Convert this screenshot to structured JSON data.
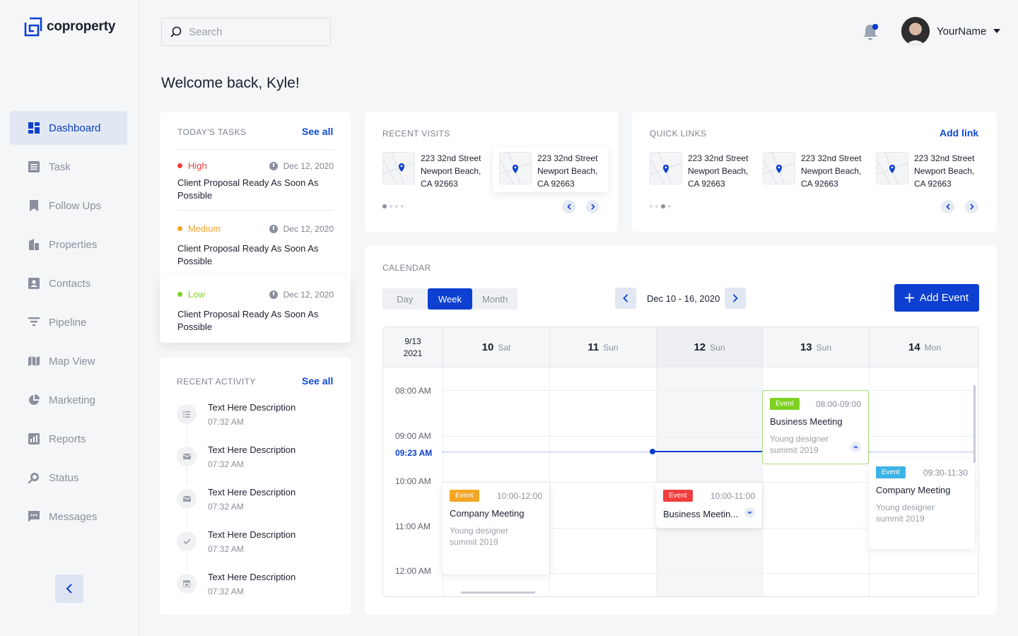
{
  "brand": {
    "name": "coproperty",
    "accent": "#0d3fd1"
  },
  "sidebar": {
    "items": [
      {
        "label": "Dashboard",
        "icon": "dashboard-icon",
        "active": true
      },
      {
        "label": "Task",
        "icon": "task-icon"
      },
      {
        "label": "Follow Ups",
        "icon": "bookmark-icon"
      },
      {
        "label": "Properties",
        "icon": "building-icon"
      },
      {
        "label": "Contacts",
        "icon": "contact-icon"
      },
      {
        "label": "Pipeline",
        "icon": "filter-icon"
      },
      {
        "label": "Map View",
        "icon": "map-icon"
      },
      {
        "label": "Marketing",
        "icon": "pie-chart-icon"
      },
      {
        "label": "Reports",
        "icon": "reports-icon"
      },
      {
        "label": "Status",
        "icon": "status-icon"
      },
      {
        "label": "Messages",
        "icon": "messages-icon"
      }
    ]
  },
  "header": {
    "search_placeholder": "Search",
    "username": "YourName",
    "welcome": "Welcome back, Kyle!"
  },
  "tasks": {
    "label": "TODAY'S TASKS",
    "see_all": "See all",
    "items": [
      {
        "priority": "High",
        "color": "#f03d3d",
        "date": "Dec 12, 2020",
        "title": "Client Proposal Ready As Soon As Possible"
      },
      {
        "priority": "Medium",
        "color": "#f5a524",
        "date": "Dec 12, 2020",
        "title": "Client Proposal Ready As Soon As Possible"
      },
      {
        "priority": "Low",
        "color": "#7ed321",
        "date": "Dec 12, 2020",
        "title": "Client Proposal Ready As Soon As Possible"
      }
    ]
  },
  "activity": {
    "label": "RECENT ACTIVITY",
    "see_all": "See all",
    "items": [
      {
        "title": "Text Here Description",
        "time": "07:32 AM",
        "icon": "list-icon"
      },
      {
        "title": "Text Here Description",
        "time": "07:32 AM",
        "icon": "mail-icon"
      },
      {
        "title": "Text Here Description",
        "time": "07:32 AM",
        "icon": "mail-icon"
      },
      {
        "title": "Text Here Description",
        "time": "07:32 AM",
        "icon": "check-icon"
      },
      {
        "title": "Text Here Description",
        "time": "07:32 AM",
        "icon": "calendar-icon"
      }
    ]
  },
  "visits": {
    "label": "RECENT VISITS",
    "places": [
      {
        "line1": "223 32nd Street",
        "line2": "Newport Beach,",
        "line3": "CA 92663"
      },
      {
        "line1": "223 32nd Street",
        "line2": "Newport Beach,",
        "line3": "CA 92663"
      }
    ]
  },
  "quick": {
    "label": "QUICK LINKS",
    "add_link": "Add link",
    "places": [
      {
        "line1": "223 32nd Street",
        "line2": "Newport Beach,",
        "line3": "CA 92663"
      },
      {
        "line1": "223 32nd Street",
        "line2": "Newport Beach,",
        "line3": "CA 92663"
      },
      {
        "line1": "223 32nd Street",
        "line2": "Newport Beach,",
        "line3": "CA 92663"
      }
    ]
  },
  "calendar": {
    "label": "CALENDAR",
    "views": [
      "Day",
      "Week",
      "Month"
    ],
    "active_view": "Week",
    "range": "Dec 10 - 16, 2020",
    "add_event": "Add Event",
    "corner_line1": "9/13",
    "corner_line2": "2021",
    "days": [
      {
        "num": "10",
        "day": "Sat"
      },
      {
        "num": "11",
        "day": "Sun"
      },
      {
        "num": "12",
        "day": "Sun"
      },
      {
        "num": "13",
        "day": "Sun"
      },
      {
        "num": "14",
        "day": "Mon"
      }
    ],
    "times": [
      "08:00 AM",
      "09:00 AM",
      "10:00 AM",
      "11:00 AM",
      "12:00 AM"
    ],
    "now": "09:23 AM",
    "events": [
      {
        "badge": "Event",
        "badge_color": "#7ed321",
        "time": "08:00-09:00",
        "title": "Business Meeting",
        "sub_line1": "Young designer",
        "sub_line2": "summit 2019"
      },
      {
        "badge": "Event",
        "badge_color": "#f5a524",
        "time": "10:00-12:00",
        "title": "Company Meeting",
        "sub_line1": "Young designer",
        "sub_line2": "summit 2019"
      },
      {
        "badge": "Event",
        "badge_color": "#f03d3d",
        "time": "10:00-11:00",
        "title": "Business Meetin..."
      },
      {
        "badge": "Event",
        "badge_color": "#3bb3e6",
        "time": "09:30-11:30",
        "title": "Company Meeting",
        "sub_line1": "Young designer",
        "sub_line2": "summit 2019"
      }
    ]
  }
}
